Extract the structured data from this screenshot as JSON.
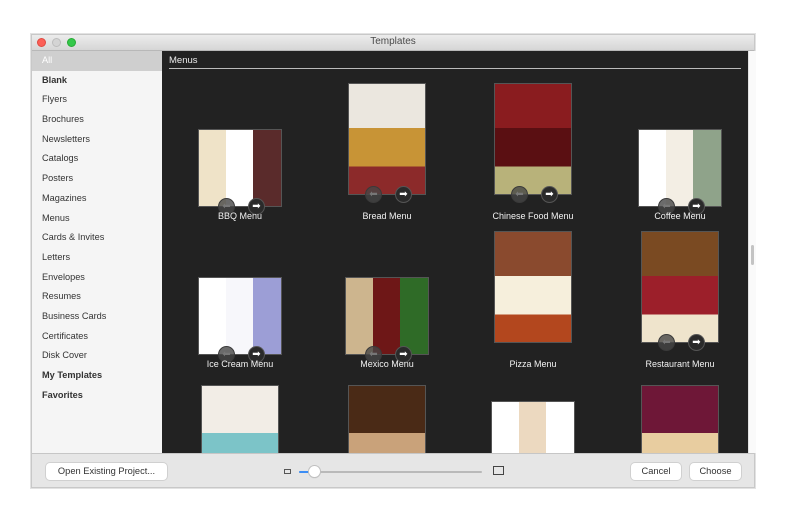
{
  "window": {
    "title": "Templates"
  },
  "sidebar": {
    "items": [
      {
        "label": "All",
        "selected": true,
        "bold": false
      },
      {
        "label": "Blank",
        "selected": false,
        "bold": true
      },
      {
        "label": "Flyers",
        "selected": false,
        "bold": false
      },
      {
        "label": "Brochures",
        "selected": false,
        "bold": false
      },
      {
        "label": "Newsletters",
        "selected": false,
        "bold": false
      },
      {
        "label": "Catalogs",
        "selected": false,
        "bold": false
      },
      {
        "label": "Posters",
        "selected": false,
        "bold": false
      },
      {
        "label": "Magazines",
        "selected": false,
        "bold": false
      },
      {
        "label": "Menus",
        "selected": false,
        "bold": false
      },
      {
        "label": "Cards & Invites",
        "selected": false,
        "bold": false
      },
      {
        "label": "Letters",
        "selected": false,
        "bold": false
      },
      {
        "label": "Envelopes",
        "selected": false,
        "bold": false
      },
      {
        "label": "Resumes",
        "selected": false,
        "bold": false
      },
      {
        "label": "Business Cards",
        "selected": false,
        "bold": false
      },
      {
        "label": "Certificates",
        "selected": false,
        "bold": false
      },
      {
        "label": "Disk Cover",
        "selected": false,
        "bold": false
      },
      {
        "label": "My Templates",
        "selected": false,
        "bold": true
      },
      {
        "label": "Favorites",
        "selected": false,
        "bold": true
      }
    ]
  },
  "content": {
    "section_title": "Menus",
    "templates": [
      {
        "name": "BBQ Menu",
        "orientation": "landscape",
        "has_pager": true,
        "colors": [
          "#efe3c8",
          "#ffffff",
          "#5a2b2b"
        ]
      },
      {
        "name": "Bread Menu",
        "orientation": "portrait",
        "has_pager": true,
        "colors": [
          "#ebe7df",
          "#c89436",
          "#8c2a2a"
        ]
      },
      {
        "name": "Chinese Food Menu",
        "orientation": "portrait",
        "has_pager": true,
        "colors": [
          "#8a1c1f",
          "#5a0f12",
          "#b8b27a"
        ]
      },
      {
        "name": "Coffee Menu",
        "orientation": "landscape",
        "has_pager": true,
        "colors": [
          "#ffffff",
          "#f3eee4",
          "#8fa38a"
        ]
      },
      {
        "name": "Ice Cream Menu",
        "orientation": "landscape",
        "has_pager": true,
        "colors": [
          "#ffffff",
          "#f7f7fb",
          "#9c9ed6"
        ]
      },
      {
        "name": "Mexico Menu",
        "orientation": "landscape",
        "has_pager": true,
        "colors": [
          "#cdb58e",
          "#6e1717",
          "#2f6b27"
        ]
      },
      {
        "name": "Pizza Menu",
        "orientation": "portrait",
        "has_pager": false,
        "colors": [
          "#8a4a2e",
          "#f6efdc",
          "#b3471e"
        ]
      },
      {
        "name": "Restaurant Menu",
        "orientation": "portrait",
        "has_pager": true,
        "colors": [
          "#7a4a22",
          "#9c1f2a",
          "#efe4cc"
        ]
      },
      {
        "name": "",
        "orientation": "portrait",
        "has_pager": false,
        "colors": [
          "#f2ede6",
          "#7cc4c8",
          "#f3c25e"
        ]
      },
      {
        "name": "",
        "orientation": "portrait",
        "has_pager": false,
        "colors": [
          "#4a2a16",
          "#c9a27a",
          "#6b4a32"
        ]
      },
      {
        "name": "",
        "orientation": "landscape",
        "has_pager": false,
        "colors": [
          "#ffffff",
          "#ecd9c0",
          "#ffffff"
        ]
      },
      {
        "name": "",
        "orientation": "portrait",
        "has_pager": false,
        "colors": [
          "#6e1737",
          "#e8cda0",
          "#a8553a"
        ]
      }
    ]
  },
  "footer": {
    "open_existing_label": "Open Existing Project...",
    "cancel_label": "Cancel",
    "choose_label": "Choose",
    "zoom_slider_value": 0.08
  },
  "icons": {
    "prev": "arrow-left-icon",
    "next": "arrow-right-icon",
    "small_thumb": "small-thumbnail-icon",
    "large_thumb": "large-thumbnail-icon"
  },
  "colors": {
    "content_bg": "#222222",
    "sidebar_bg": "#f5f5f5",
    "selected_bg": "#cfcfcf",
    "slider_accent": "#3d8ef5"
  }
}
